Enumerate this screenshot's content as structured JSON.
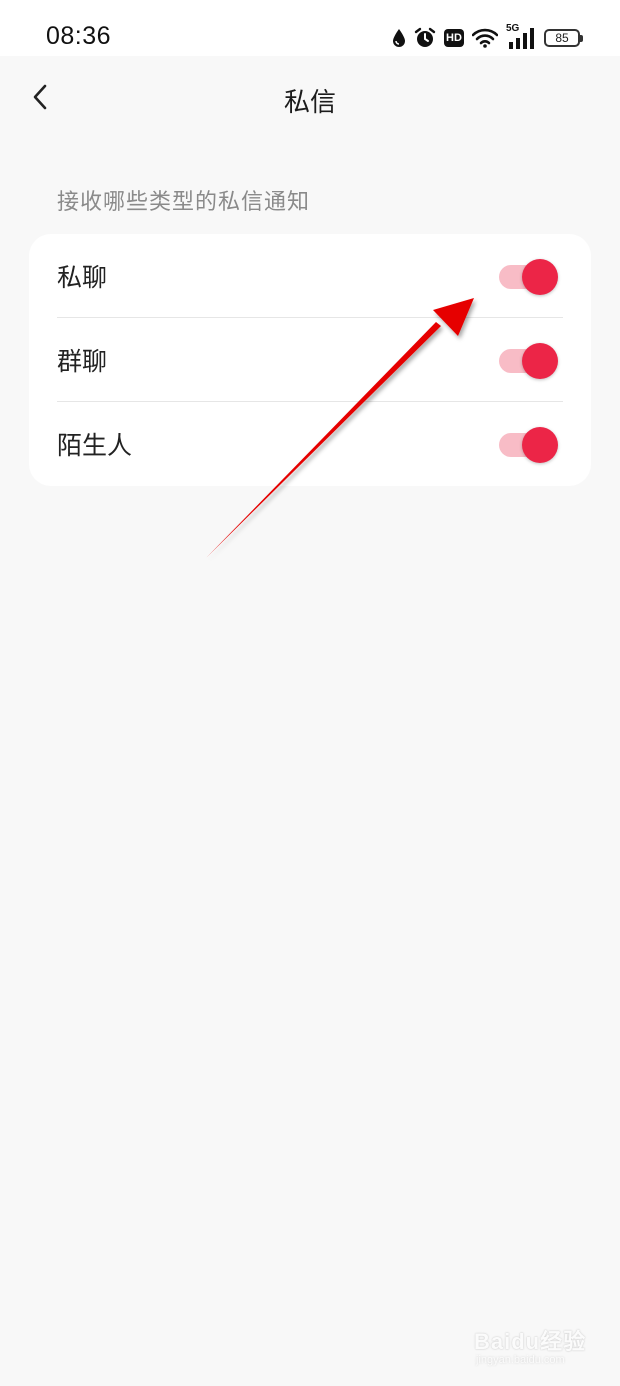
{
  "status_bar": {
    "time": "08:36",
    "icons": [
      "water-drop-icon",
      "alarm-icon",
      "hd-icon",
      "wifi-icon",
      "signal-5g-icon",
      "battery-icon"
    ],
    "hd_label": "HD",
    "network_label": "5G",
    "battery_level": "85"
  },
  "header": {
    "back_icon": "chevron-left-icon",
    "title": "私信"
  },
  "section": {
    "label": "接收哪些类型的私信通知"
  },
  "settings": [
    {
      "label": "私聊",
      "enabled": true
    },
    {
      "label": "群聊",
      "enabled": true
    },
    {
      "label": "陌生人",
      "enabled": true
    }
  ],
  "colors": {
    "accent": "#ec2547",
    "toggle_track_on": "#f8bcc6",
    "background": "#f8f8f8",
    "card": "#ffffff",
    "annotation_arrow": "#e60000"
  },
  "watermark": {
    "brand": "Baidu经验",
    "sub": "jingyan.baidu.com"
  }
}
